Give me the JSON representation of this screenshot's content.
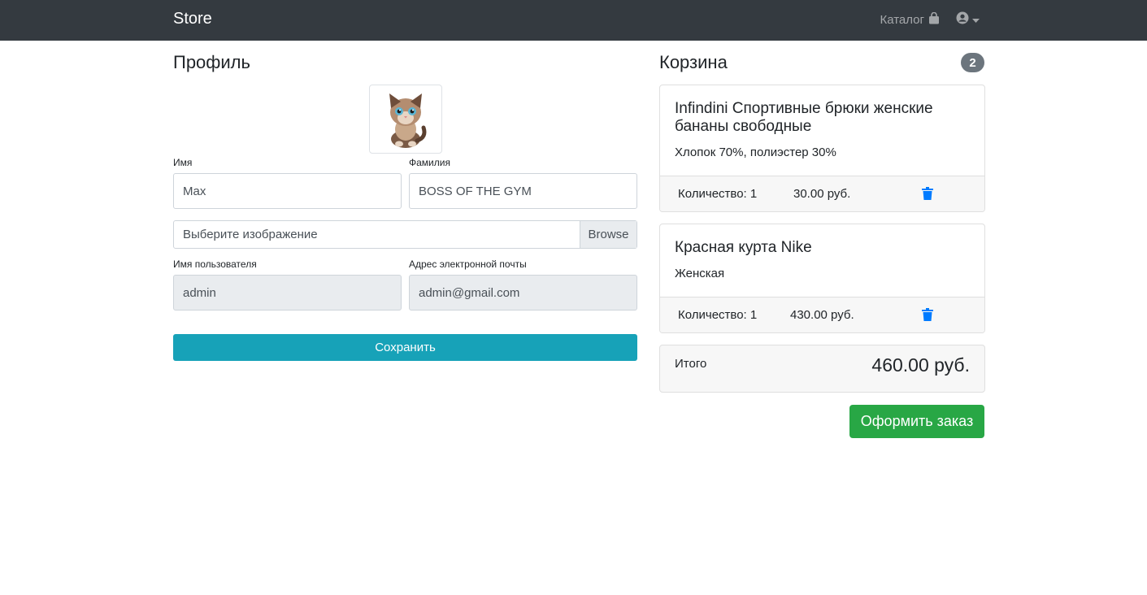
{
  "navbar": {
    "brand": "Store",
    "catalog_label": "Каталог",
    "catalog_icon": "shopping-bag-icon",
    "user_icon": "user-circle-icon"
  },
  "profile": {
    "title": "Профиль",
    "first_name_label": "Имя",
    "first_name_value": "Max",
    "last_name_label": "Фамилия",
    "last_name_value": "BOSS OF THE GYM",
    "file_placeholder": "Выберите изображение",
    "browse_label": "Browse",
    "username_label": "Имя пользователя",
    "username_value": "admin",
    "email_label": "Адрес электронной почты",
    "email_value": "admin@gmail.com",
    "save_label": "Сохранить"
  },
  "cart": {
    "title": "Корзина",
    "count": "2",
    "items": [
      {
        "name": "Infindini Спортивные брюки женские бананы свободные",
        "description": "Хлопок 70%, полиэстер 30%",
        "quantity": "Количество: 1",
        "price": "30.00 руб."
      },
      {
        "name": "Красная курта Nike",
        "description": "Женская",
        "quantity": "Количество: 1",
        "price": "430.00 руб."
      }
    ],
    "total_label": "Итого",
    "total_value": "460.00 руб.",
    "order_label": "Оформить заказ"
  },
  "colors": {
    "navbar": "#343a40",
    "save_button": "#17a2b8",
    "order_button": "#28a745",
    "trash_icon": "#007bff",
    "badge": "#6c757d"
  }
}
